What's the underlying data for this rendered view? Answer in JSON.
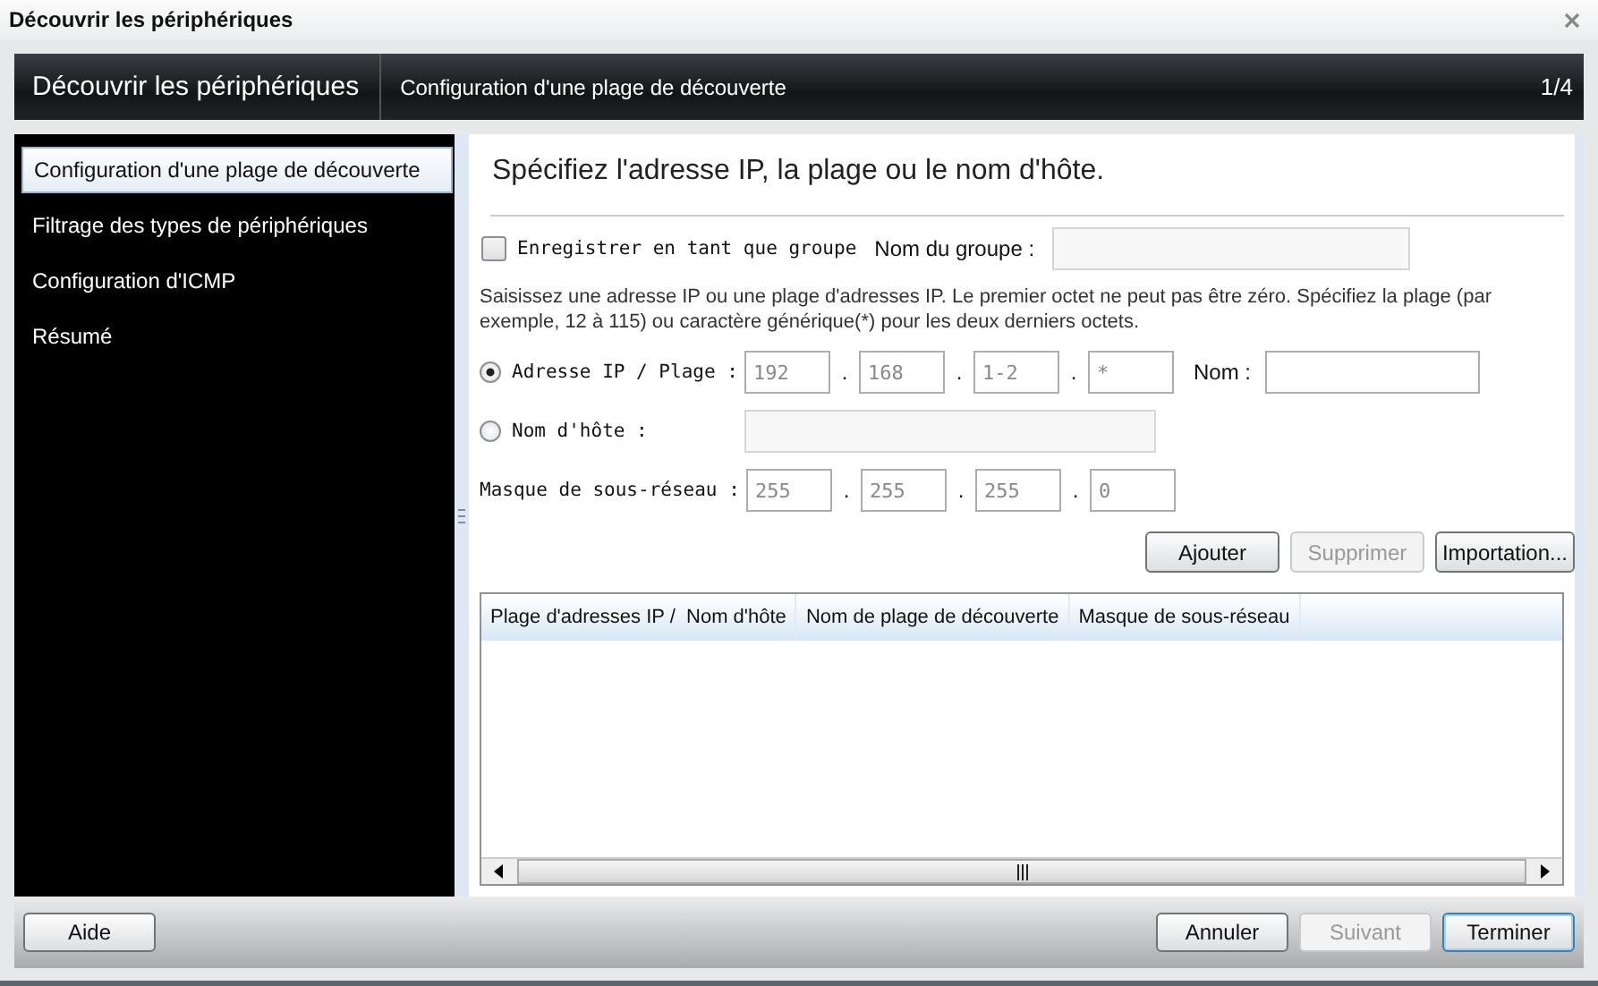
{
  "window": {
    "title": "Découvrir les périphériques"
  },
  "header": {
    "title": "Découvrir les périphériques",
    "step": "Configuration d'une plage de découverte",
    "counter": "1/4"
  },
  "sidebar": {
    "items": [
      {
        "label": "Configuration d'une plage de découverte",
        "selected": true
      },
      {
        "label": "Filtrage des types de périphériques",
        "selected": false
      },
      {
        "label": "Configuration d'ICMP",
        "selected": false
      },
      {
        "label": "Résumé",
        "selected": false
      }
    ]
  },
  "content": {
    "heading": "Spécifiez l'adresse IP, la plage ou le nom d'hôte.",
    "group": {
      "label": "Enregistrer en tant que groupe",
      "checked": false,
      "name_label": "Nom du groupe :",
      "name_disabled": true
    },
    "instructions": "Saisissez une adresse IP ou une plage d'adresses IP. Le premier octet ne peut pas être zéro. Spécifiez la plage (par exemple, 12 à 115) ou caractère générique(*) pour les deux derniers octets.",
    "modes": [
      {
        "kind": "ip",
        "label": "Adresse IP / Plage :",
        "selected": true,
        "octets": [
          "192",
          "168",
          "1-2",
          "*"
        ],
        "separators": [
          ".",
          ".",
          "."
        ],
        "name_label": "Nom :"
      },
      {
        "kind": "host",
        "label": "Nom d'hôte :",
        "selected": false,
        "disabled": true
      }
    ],
    "mask": {
      "label": "Masque de sous-réseau :",
      "octets": [
        "255",
        "255",
        "255",
        "0"
      ],
      "separators": [
        ".",
        ".",
        "."
      ]
    },
    "buttons": [
      {
        "label": "Ajouter",
        "disabled": false
      },
      {
        "label": "Supprimer",
        "disabled": true
      },
      {
        "label": "Importation...",
        "disabled": false
      }
    ],
    "table": {
      "columns": [
        "Plage d'adresses IP /  Nom d'hôte",
        "Nom de plage de découverte",
        "Masque de sous-réseau"
      ]
    }
  },
  "footer": {
    "help": "Aide",
    "buttons": [
      {
        "label": "Annuler",
        "disabled": false,
        "default": false
      },
      {
        "label": "Suivant",
        "disabled": true,
        "default": false
      },
      {
        "label": "Terminer",
        "disabled": false,
        "default": true
      }
    ]
  }
}
